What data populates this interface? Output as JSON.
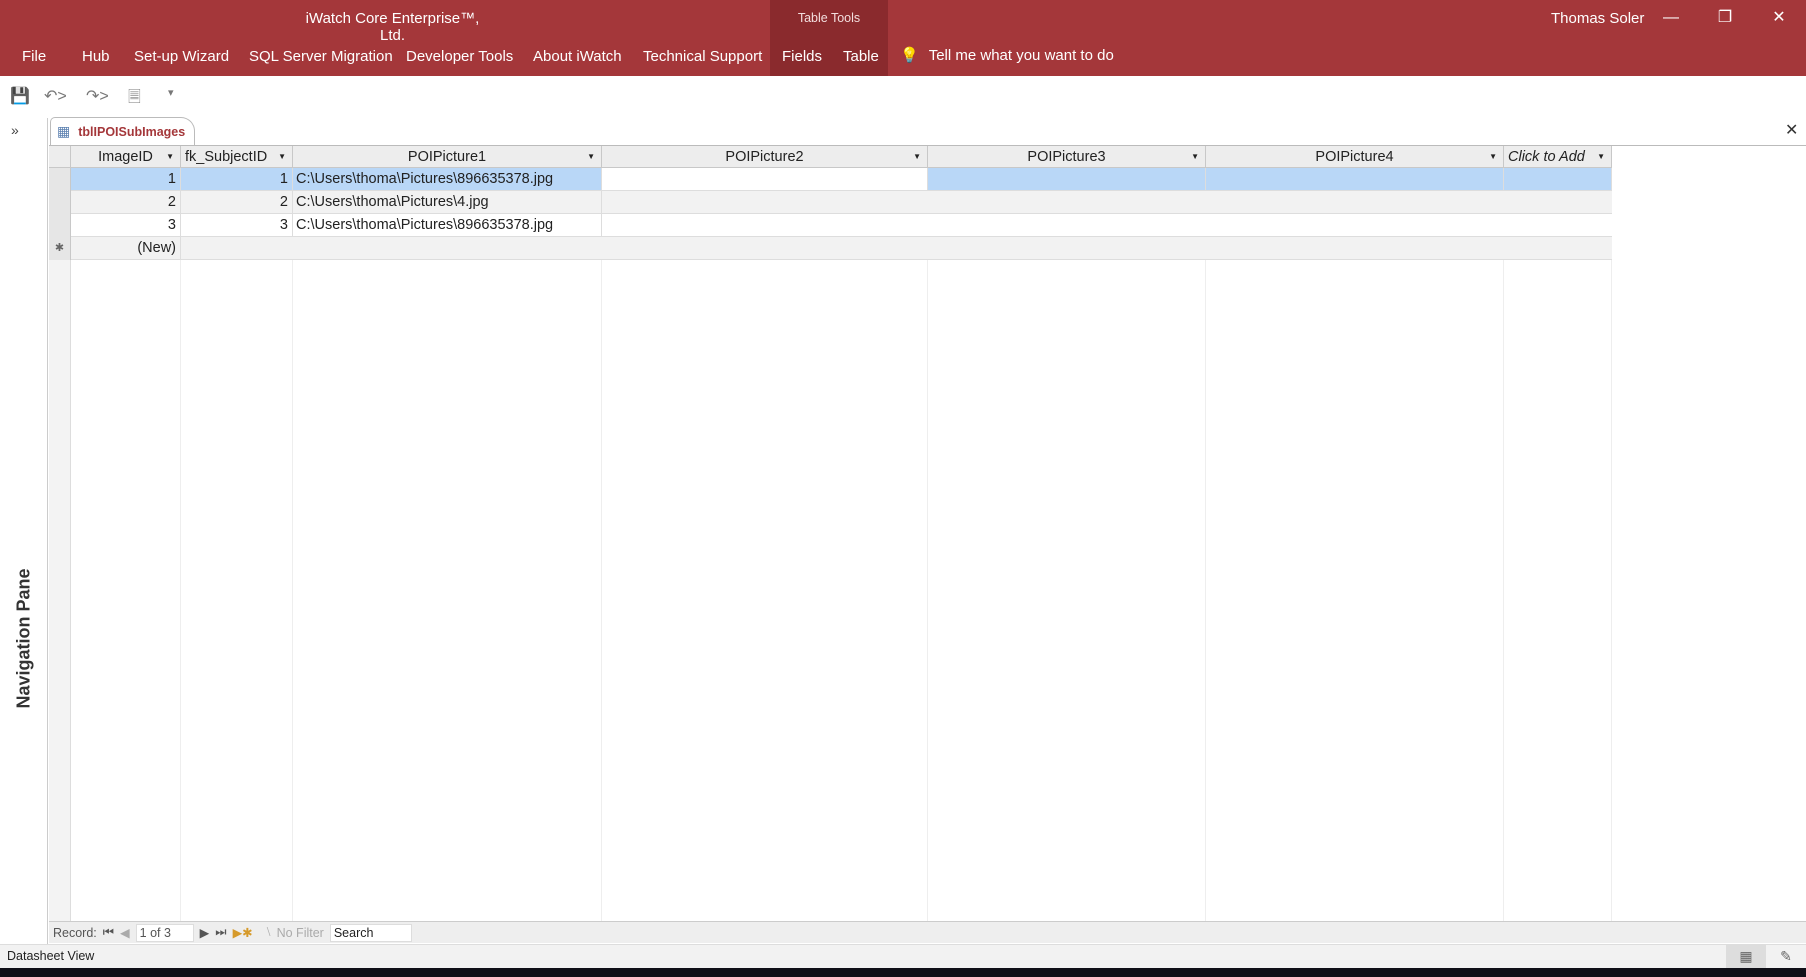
{
  "window": {
    "title": "iWatch Core Enterprise™, Ltd.",
    "context_tab": "Table Tools",
    "user": "Thomas Soler"
  },
  "menu": [
    "File",
    "Hub",
    "Set-up Wizard",
    "SQL Server Migration",
    "Developer Tools",
    "About iWatch",
    "Technical Support",
    "Fields",
    "Table"
  ],
  "tell_me": "Tell me what you want to do",
  "nav_pane": {
    "label": "Navigation Pane"
  },
  "document_tab": "tblIPOISubImages",
  "table": {
    "columns": [
      "ImageID",
      "fk_SubjectID",
      "POIPicture1",
      "POIPicture2",
      "POIPicture3",
      "POIPicture4",
      "Click to Add"
    ],
    "rows": [
      {
        "ImageID": "1",
        "fk_SubjectID": "1",
        "POIPicture1": "C:\\Users\\thoma\\Pictures\\896635378.jpg"
      },
      {
        "ImageID": "2",
        "fk_SubjectID": "2",
        "POIPicture1": "C:\\Users\\thoma\\Pictures\\4.jpg"
      },
      {
        "ImageID": "3",
        "fk_SubjectID": "3",
        "POIPicture1": "C:\\Users\\thoma\\Pictures\\896635378.jpg"
      }
    ],
    "new_row": "(New)"
  },
  "record_nav": {
    "label": "Record:",
    "position": "1 of 3",
    "filter": "No Filter",
    "search": "Search"
  },
  "status": {
    "view": "Datasheet View"
  }
}
